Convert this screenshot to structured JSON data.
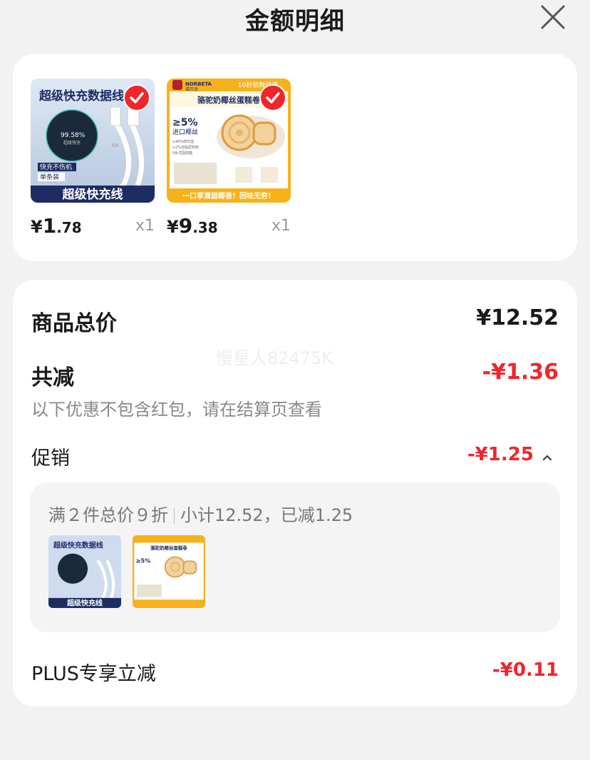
{
  "header": {
    "title": "金额明细"
  },
  "products": [
    {
      "image_caption": "超级快充数据线",
      "image_badge": "超级快充线",
      "image_tag1": "快充不伤机",
      "image_tag2": "单条装",
      "image_percent": "99.58%",
      "image_subtext": "超级快充",
      "image_cable_mark": "6A",
      "price_currency": "¥",
      "price_int": "1",
      "price_dec": ".78",
      "qty": "x1"
    },
    {
      "image_brand": "NORBETA",
      "image_brand_cn": "诺贝达",
      "image_banner": "10秒锁鲜烘焙",
      "image_title": "骆驼奶椰丝蛋糕卷",
      "image_percent": "≥5%",
      "image_sub": "进口椰丝",
      "image_bullets": [
        "≥40%鲜鸡蛋",
        "≥2%全脂驼奶粉",
        "0反式脂肪酸"
      ],
      "image_footer": "一口享清甜椰香！回味无穷！",
      "price_currency": "¥",
      "price_int": "9",
      "price_dec": ".38",
      "qty": "x1"
    }
  ],
  "summary": {
    "total_label": "商品总价",
    "total_value": "¥12.52",
    "discount_label": "共减",
    "discount_value": "-¥1.36",
    "discount_note": "以下优惠不包含红包，请在结算页查看",
    "watermark": "慢星人82475K",
    "promo_label": "促销",
    "promo_value": "-¥1.25",
    "promo_detail_a": "满２件总价９折",
    "promo_detail_b": "小计12.52，已减1.25",
    "plus_label": "PLUS专享立减",
    "plus_value": "-¥0.11"
  },
  "colors": {
    "accent_red": "#f0262a",
    "background": "#f2f2f2",
    "card": "#ffffff"
  }
}
